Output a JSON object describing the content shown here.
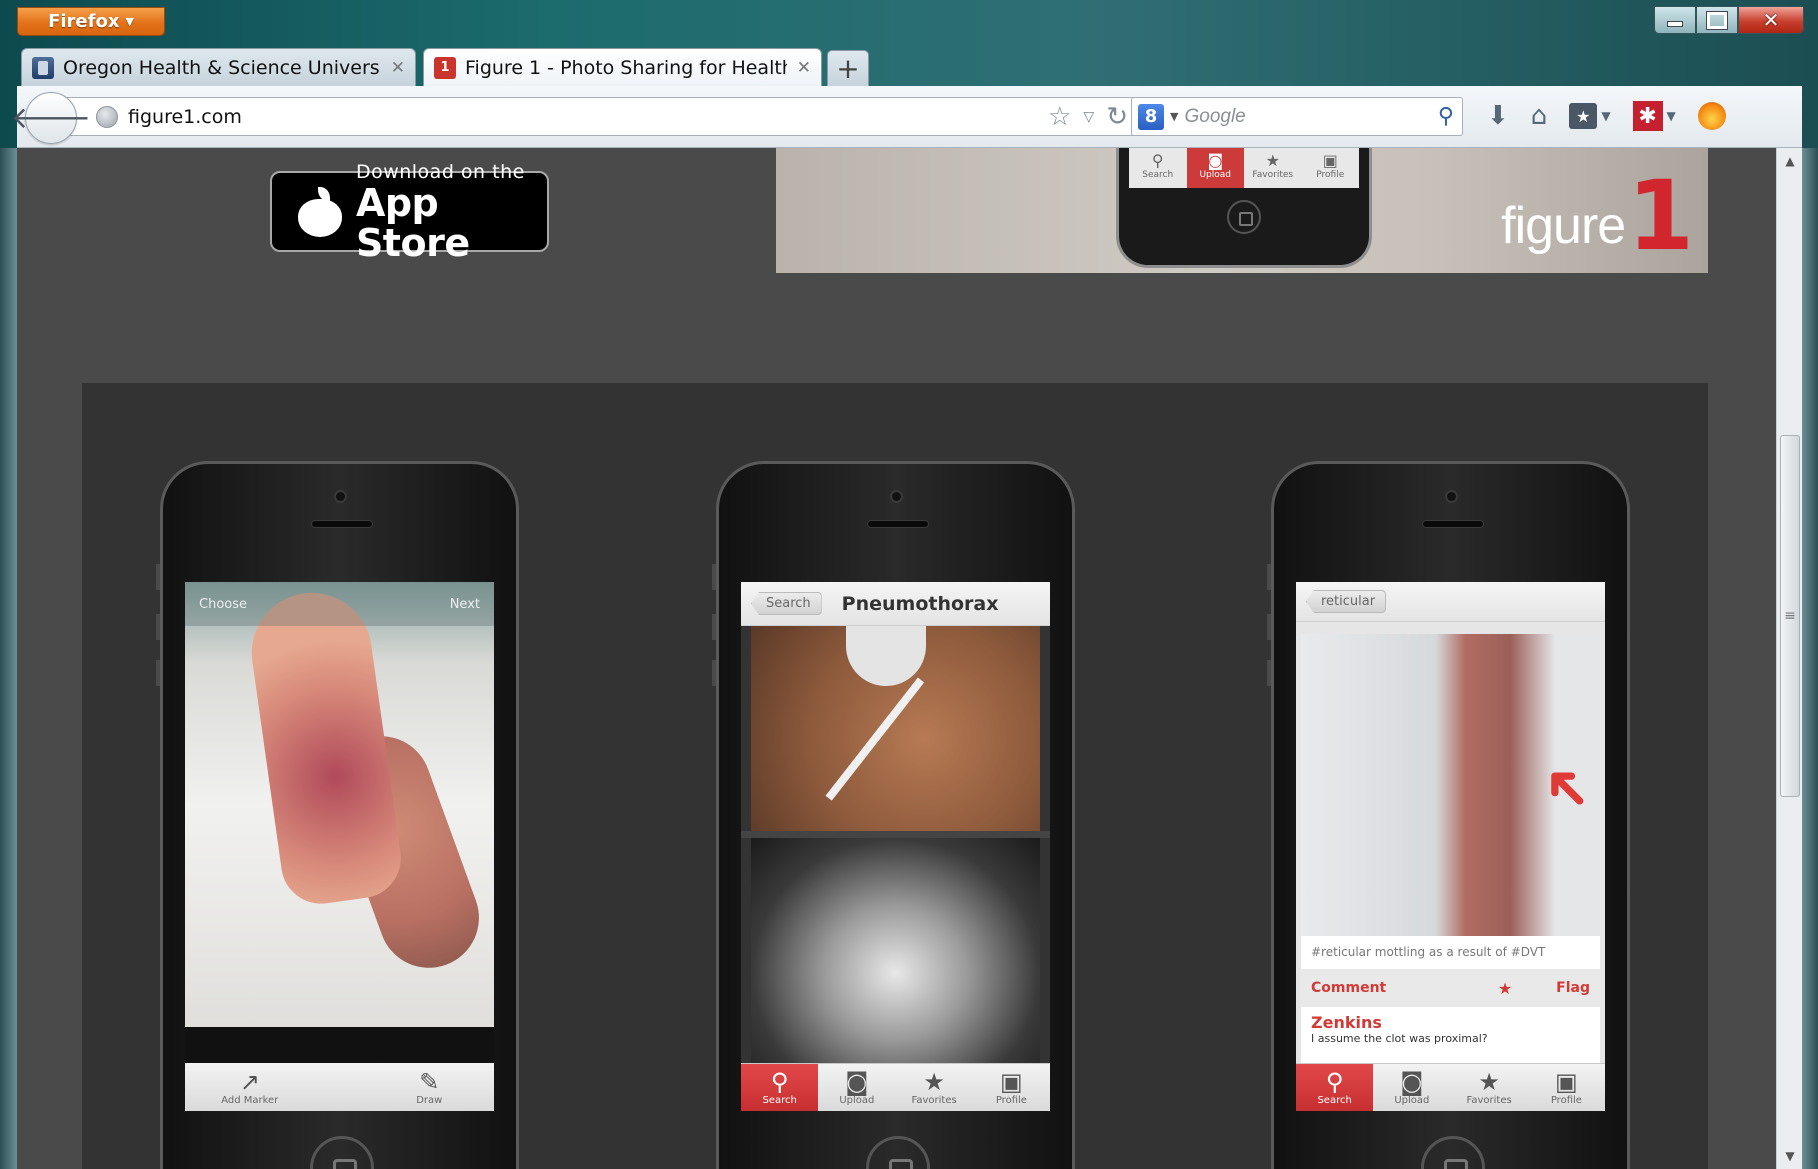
{
  "browser": {
    "menu_button": "Firefox",
    "tabs": [
      {
        "label": "Oregon Health & Science University | ...",
        "active": false
      },
      {
        "label": "Figure 1 - Photo Sharing for Healthcare",
        "active": true
      }
    ],
    "new_tab_label": "+",
    "url": "figure1.com",
    "search_placeholder": "Google",
    "search_engine_badge": "8",
    "ext_badge": "✱"
  },
  "page": {
    "appstore": {
      "small": "Download on the",
      "big": "App Store"
    },
    "banner": {
      "logo_word": "figure",
      "logo_num": "1",
      "tabs": [
        "Search",
        "Upload",
        "Favorites",
        "Profile"
      ]
    },
    "phone1": {
      "left_label": "Choose",
      "right_label": "Next",
      "tools": [
        "Add Marker",
        "Draw"
      ]
    },
    "phone2": {
      "back_label": "Search",
      "title": "Pneumothorax",
      "tabs": [
        "Search",
        "Upload",
        "Favorites",
        "Profile"
      ]
    },
    "phone3": {
      "back_label": "reticular",
      "caption": "#reticular mottling as a result of #DVT",
      "comment_label": "Comment",
      "flag_label": "Flag",
      "commenter": "Zenkins",
      "comment_text": "I assume the clot was proximal?",
      "tabs": [
        "Search",
        "Upload",
        "Favorites",
        "Profile"
      ]
    }
  },
  "icons": {
    "tab": [
      "search-icon",
      "camera-icon",
      "star-icon",
      "inbox-icon"
    ]
  },
  "colors": {
    "accent_red": "#d2262f",
    "firefox_orange": "#e2721b",
    "page_bg": "#4a4a4a"
  }
}
